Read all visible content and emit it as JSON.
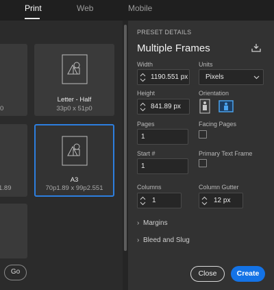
{
  "tabs": [
    {
      "label": "Print",
      "active": true
    },
    {
      "label": "Web",
      "active": false
    },
    {
      "label": "Mobile",
      "active": false
    }
  ],
  "presets": [
    {
      "name": "",
      "size": "0"
    },
    {
      "name": "Letter - Half",
      "size": "33p0 x 51p0"
    },
    {
      "name": "",
      "size": "1.89"
    },
    {
      "name": "A3",
      "size": "70p1.89 x 99p2.551",
      "selected": true
    },
    {
      "name": "",
      "size": ""
    }
  ],
  "search": {
    "go_label": "Go"
  },
  "details": {
    "section_label": "PRESET DETAILS",
    "title": "Multiple Frames",
    "width_label": "Width",
    "width_value": "1190.551 px",
    "units_label": "Units",
    "units_value": "Pixels",
    "height_label": "Height",
    "height_value": "841.89 px",
    "orientation_label": "Orientation",
    "pages_label": "Pages",
    "pages_value": "1",
    "facing_pages_label": "Facing Pages",
    "start_label": "Start #",
    "start_value": "1",
    "primary_text_frame_label": "Primary Text Frame",
    "columns_label": "Columns",
    "columns_value": "1",
    "column_gutter_label": "Column Gutter",
    "column_gutter_value": "12 px",
    "margins_label": "Margins",
    "bleed_label": "Bleed and Slug",
    "close_label": "Close",
    "create_label": "Create"
  },
  "colors": {
    "accent": "#1473e6",
    "selected_border": "#2d7fe0",
    "orientation_active": "#4aa3f0"
  }
}
